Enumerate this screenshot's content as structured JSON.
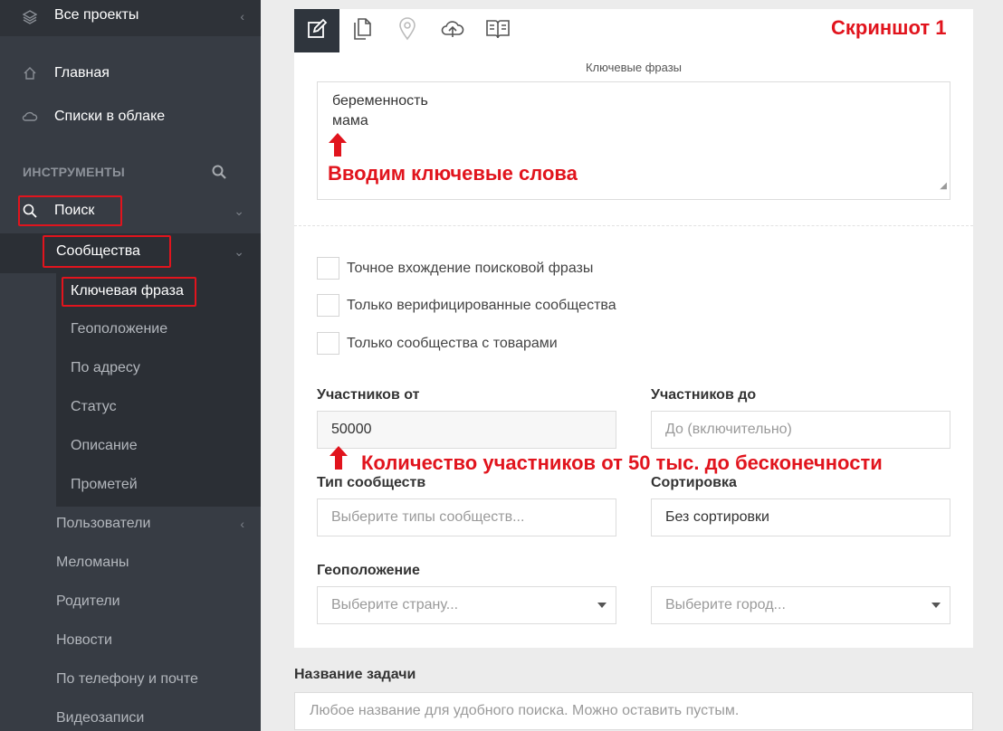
{
  "sidebar": {
    "top_item": "Все проекты",
    "items": [
      {
        "label": "Главная",
        "icon": "home-icon"
      },
      {
        "label": "Списки в облаке",
        "icon": "cloud-icon"
      }
    ],
    "section_title": "ИНСТРУМЕНТЫ",
    "search_label": "Поиск",
    "communities_label": "Сообщества",
    "community_subitems": [
      "Ключевая фраза",
      "Геоположение",
      "По адресу",
      "Статус",
      "Описание",
      "Прометей"
    ],
    "lower_items": [
      "Пользователи",
      "Меломаны",
      "Родители",
      "Новости",
      "По телефону и почте",
      "Видеозаписи"
    ]
  },
  "annotation": {
    "screenshot_label": "Скриншот 1",
    "keywords_note": "Вводим ключевые слова",
    "members_note": "Количество участников от 50 тыс. до бесконечности"
  },
  "form": {
    "keywords_caption": "Ключевые фразы",
    "keywords_lines": [
      "беременность",
      "мама"
    ],
    "checkboxes": [
      "Точное вхождение поисковой фразы",
      "Только верифицированные сообщества",
      "Только сообщества с товарами"
    ],
    "members_from_label": "Участников от",
    "members_from_value": "50000",
    "members_to_label": "Участников до",
    "members_to_placeholder": "До (включительно)",
    "type_label": "Тип сообществ",
    "type_placeholder": "Выберите типы сообществ...",
    "sort_label": "Сортировка",
    "sort_value": "Без сортировки",
    "geo_label": "Геоположение",
    "country_placeholder": "Выберите страну...",
    "city_placeholder": "Выберите город..."
  },
  "task": {
    "label": "Название задачи",
    "placeholder": "Любое название для удобного поиска. Можно оставить пустым."
  },
  "colors": {
    "sidebar_bg": "#373c44",
    "annotation_red": "#e1141d",
    "active_tab": "#2f353d"
  }
}
